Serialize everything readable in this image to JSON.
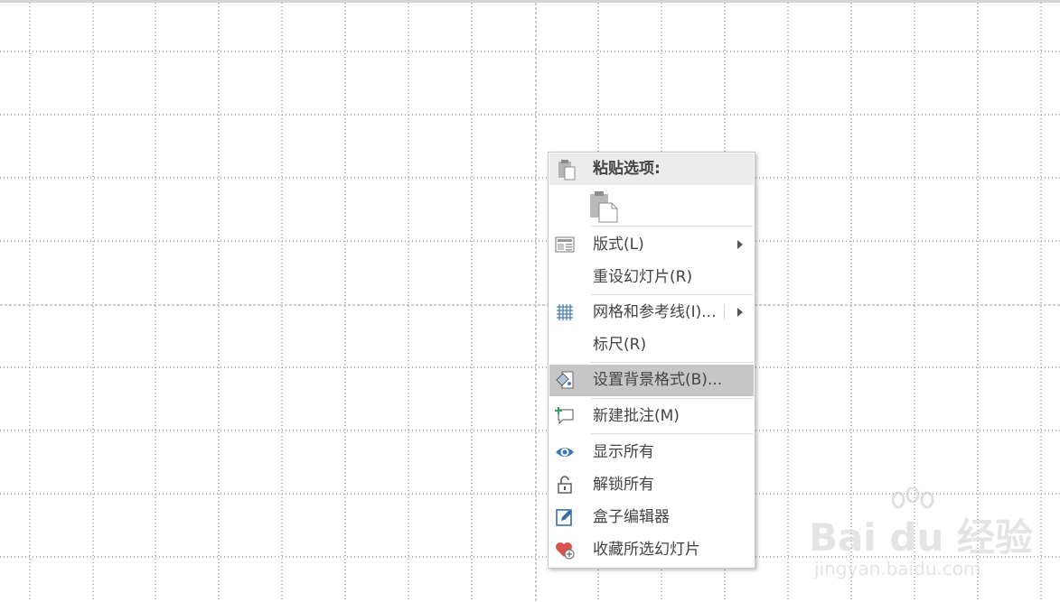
{
  "context_menu": {
    "paste_header": "粘贴选项:",
    "items": [
      {
        "label": "版式(L)",
        "has_submenu": true,
        "icon": "layout-icon"
      },
      {
        "label": "重设幻灯片(R)",
        "has_submenu": false,
        "icon": ""
      },
      {
        "label": "网格和参考线(I)...",
        "has_submenu": true,
        "icon": "grid-icon"
      },
      {
        "label": "标尺(R)",
        "has_submenu": false,
        "icon": ""
      },
      {
        "label": "设置背景格式(B)...",
        "has_submenu": false,
        "icon": "background-format-icon",
        "highlighted": true
      },
      {
        "label": "新建批注(M)",
        "has_submenu": false,
        "icon": "new-comment-icon"
      },
      {
        "label": "显示所有",
        "has_submenu": false,
        "icon": "eye-icon"
      },
      {
        "label": "解锁所有",
        "has_submenu": false,
        "icon": "unlock-icon"
      },
      {
        "label": "盒子编辑器",
        "has_submenu": false,
        "icon": "edit-icon"
      },
      {
        "label": "收藏所选幻灯片",
        "has_submenu": false,
        "icon": "heart-add-icon"
      }
    ]
  },
  "watermark": {
    "brand": "Bai du 经验",
    "url": "jingyan.baidu.com"
  },
  "colors": {
    "highlight": "#c6c6c6",
    "header_bg": "#ececec",
    "grid_dot": "#6d6d6d",
    "eye_blue": "#3a78b8",
    "heart_red": "#d9534f"
  }
}
